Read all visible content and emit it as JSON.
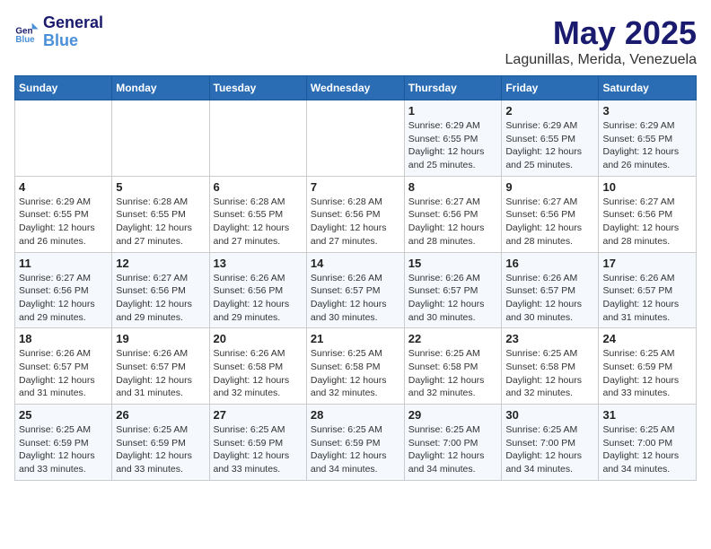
{
  "logo": {
    "line1": "General",
    "line2": "Blue"
  },
  "title": "May 2025",
  "subtitle": "Lagunillas, Merida, Venezuela",
  "days_header": [
    "Sunday",
    "Monday",
    "Tuesday",
    "Wednesday",
    "Thursday",
    "Friday",
    "Saturday"
  ],
  "weeks": [
    [
      {
        "num": "",
        "info": ""
      },
      {
        "num": "",
        "info": ""
      },
      {
        "num": "",
        "info": ""
      },
      {
        "num": "",
        "info": ""
      },
      {
        "num": "1",
        "info": "Sunrise: 6:29 AM\nSunset: 6:55 PM\nDaylight: 12 hours\nand 25 minutes."
      },
      {
        "num": "2",
        "info": "Sunrise: 6:29 AM\nSunset: 6:55 PM\nDaylight: 12 hours\nand 25 minutes."
      },
      {
        "num": "3",
        "info": "Sunrise: 6:29 AM\nSunset: 6:55 PM\nDaylight: 12 hours\nand 26 minutes."
      }
    ],
    [
      {
        "num": "4",
        "info": "Sunrise: 6:29 AM\nSunset: 6:55 PM\nDaylight: 12 hours\nand 26 minutes."
      },
      {
        "num": "5",
        "info": "Sunrise: 6:28 AM\nSunset: 6:55 PM\nDaylight: 12 hours\nand 27 minutes."
      },
      {
        "num": "6",
        "info": "Sunrise: 6:28 AM\nSunset: 6:55 PM\nDaylight: 12 hours\nand 27 minutes."
      },
      {
        "num": "7",
        "info": "Sunrise: 6:28 AM\nSunset: 6:56 PM\nDaylight: 12 hours\nand 27 minutes."
      },
      {
        "num": "8",
        "info": "Sunrise: 6:27 AM\nSunset: 6:56 PM\nDaylight: 12 hours\nand 28 minutes."
      },
      {
        "num": "9",
        "info": "Sunrise: 6:27 AM\nSunset: 6:56 PM\nDaylight: 12 hours\nand 28 minutes."
      },
      {
        "num": "10",
        "info": "Sunrise: 6:27 AM\nSunset: 6:56 PM\nDaylight: 12 hours\nand 28 minutes."
      }
    ],
    [
      {
        "num": "11",
        "info": "Sunrise: 6:27 AM\nSunset: 6:56 PM\nDaylight: 12 hours\nand 29 minutes."
      },
      {
        "num": "12",
        "info": "Sunrise: 6:27 AM\nSunset: 6:56 PM\nDaylight: 12 hours\nand 29 minutes."
      },
      {
        "num": "13",
        "info": "Sunrise: 6:26 AM\nSunset: 6:56 PM\nDaylight: 12 hours\nand 29 minutes."
      },
      {
        "num": "14",
        "info": "Sunrise: 6:26 AM\nSunset: 6:57 PM\nDaylight: 12 hours\nand 30 minutes."
      },
      {
        "num": "15",
        "info": "Sunrise: 6:26 AM\nSunset: 6:57 PM\nDaylight: 12 hours\nand 30 minutes."
      },
      {
        "num": "16",
        "info": "Sunrise: 6:26 AM\nSunset: 6:57 PM\nDaylight: 12 hours\nand 30 minutes."
      },
      {
        "num": "17",
        "info": "Sunrise: 6:26 AM\nSunset: 6:57 PM\nDaylight: 12 hours\nand 31 minutes."
      }
    ],
    [
      {
        "num": "18",
        "info": "Sunrise: 6:26 AM\nSunset: 6:57 PM\nDaylight: 12 hours\nand 31 minutes."
      },
      {
        "num": "19",
        "info": "Sunrise: 6:26 AM\nSunset: 6:57 PM\nDaylight: 12 hours\nand 31 minutes."
      },
      {
        "num": "20",
        "info": "Sunrise: 6:26 AM\nSunset: 6:58 PM\nDaylight: 12 hours\nand 32 minutes."
      },
      {
        "num": "21",
        "info": "Sunrise: 6:25 AM\nSunset: 6:58 PM\nDaylight: 12 hours\nand 32 minutes."
      },
      {
        "num": "22",
        "info": "Sunrise: 6:25 AM\nSunset: 6:58 PM\nDaylight: 12 hours\nand 32 minutes."
      },
      {
        "num": "23",
        "info": "Sunrise: 6:25 AM\nSunset: 6:58 PM\nDaylight: 12 hours\nand 32 minutes."
      },
      {
        "num": "24",
        "info": "Sunrise: 6:25 AM\nSunset: 6:59 PM\nDaylight: 12 hours\nand 33 minutes."
      }
    ],
    [
      {
        "num": "25",
        "info": "Sunrise: 6:25 AM\nSunset: 6:59 PM\nDaylight: 12 hours\nand 33 minutes."
      },
      {
        "num": "26",
        "info": "Sunrise: 6:25 AM\nSunset: 6:59 PM\nDaylight: 12 hours\nand 33 minutes."
      },
      {
        "num": "27",
        "info": "Sunrise: 6:25 AM\nSunset: 6:59 PM\nDaylight: 12 hours\nand 33 minutes."
      },
      {
        "num": "28",
        "info": "Sunrise: 6:25 AM\nSunset: 6:59 PM\nDaylight: 12 hours\nand 34 minutes."
      },
      {
        "num": "29",
        "info": "Sunrise: 6:25 AM\nSunset: 7:00 PM\nDaylight: 12 hours\nand 34 minutes."
      },
      {
        "num": "30",
        "info": "Sunrise: 6:25 AM\nSunset: 7:00 PM\nDaylight: 12 hours\nand 34 minutes."
      },
      {
        "num": "31",
        "info": "Sunrise: 6:25 AM\nSunset: 7:00 PM\nDaylight: 12 hours\nand 34 minutes."
      }
    ]
  ]
}
